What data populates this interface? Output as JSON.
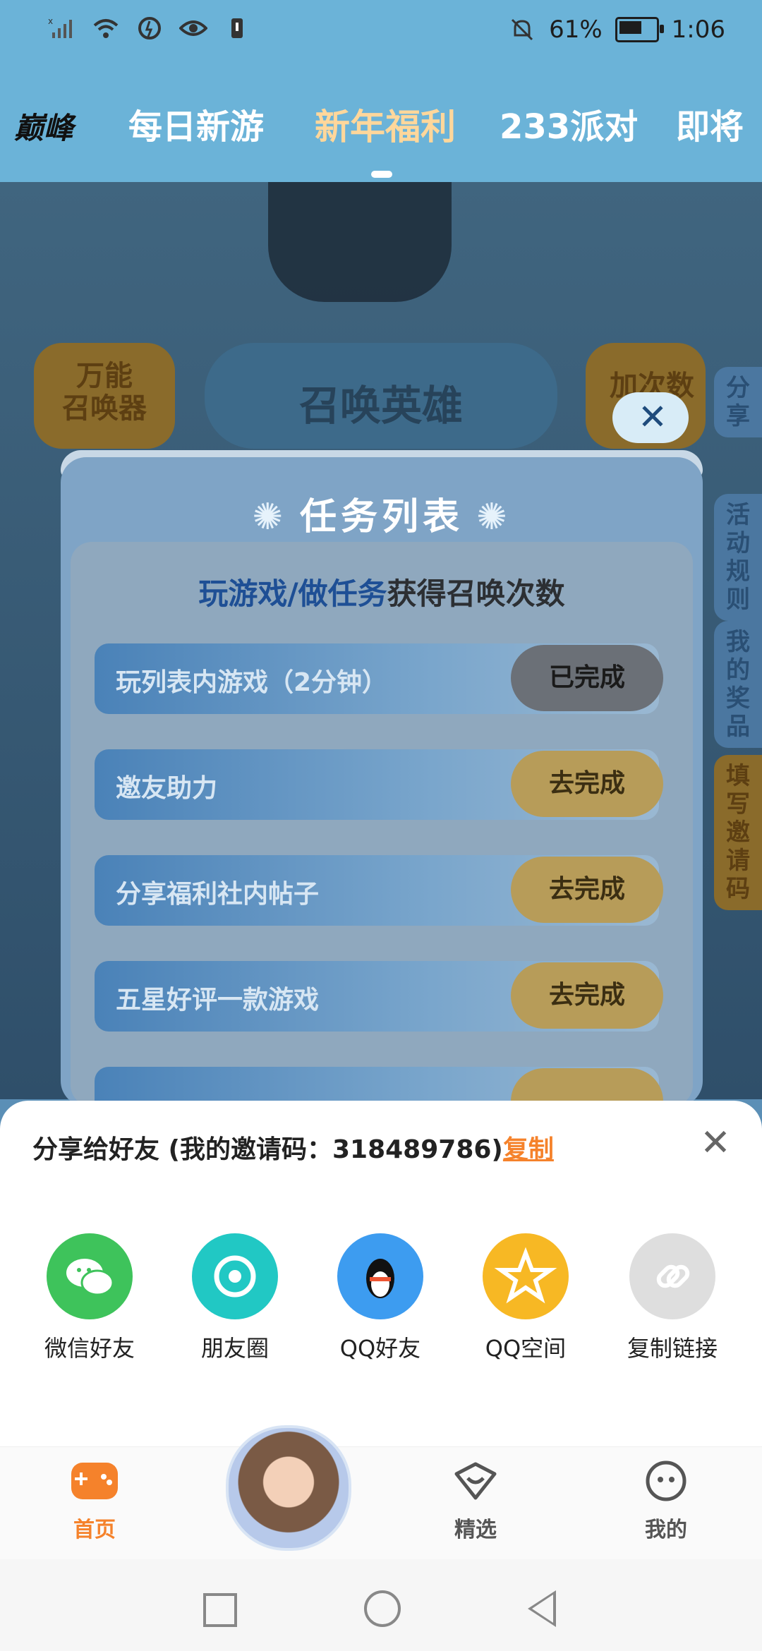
{
  "status_bar": {
    "battery_percent": "61%",
    "time": "1:06",
    "battery_level": 0.61,
    "icons": [
      "no-sim-signal-icon",
      "wifi-icon",
      "data-saver-icon",
      "eye-icon",
      "notification-icon",
      "mute-bell-icon",
      "battery-icon"
    ]
  },
  "top_tabs": {
    "items": [
      {
        "label": "巅峰",
        "active": false
      },
      {
        "label": "每日新游",
        "active": false
      },
      {
        "label": "新年福利",
        "active": true
      },
      {
        "label": "233派对",
        "active": false
      },
      {
        "label": "即将",
        "active": false
      }
    ]
  },
  "background": {
    "left_button": "万能\n召唤器",
    "main_button": "召唤英雄",
    "right_button": "加次数",
    "side_buttons": [
      "分享",
      "活动规则",
      "我的奖品",
      "填写邀请码"
    ]
  },
  "modal": {
    "title": "任务列表",
    "subtitle_highlight": "玩游戏/做任务",
    "subtitle_rest": "获得召唤次数",
    "tasks": [
      {
        "label": "玩列表内游戏（2分钟）",
        "button": "已完成",
        "done": true
      },
      {
        "label": "邀友助力",
        "button": "去完成",
        "done": false
      },
      {
        "label": "分享福利社内帖子",
        "button": "去完成",
        "done": false
      },
      {
        "label": "五星好评一款游戏",
        "button": "去完成",
        "done": false
      }
    ]
  },
  "share_sheet": {
    "title": "分享给好友 (我的邀请码：318489786)",
    "copy_label": "复制",
    "targets": [
      {
        "label": "微信好友",
        "color": "#3ec35b",
        "icon": "wechat-icon"
      },
      {
        "label": "朋友圈",
        "color": "#21c8c4",
        "icon": "moments-icon"
      },
      {
        "label": "QQ好友",
        "color": "#3d9cf0",
        "icon": "qq-penguin-icon"
      },
      {
        "label": "QQ空间",
        "color": "#f7b824",
        "icon": "qzone-star-icon"
      },
      {
        "label": "复制链接",
        "color": "#dedede",
        "icon": "link-icon"
      }
    ]
  },
  "bottom_nav": {
    "items": [
      {
        "label": "首页",
        "active": true,
        "icon": "gamepad-icon"
      },
      {
        "label": "精选",
        "active": false,
        "icon": "heart-chat-icon"
      },
      {
        "label": "我的",
        "active": false,
        "icon": "smile-face-icon"
      }
    ]
  },
  "colors": {
    "accent": "#f5822b",
    "tab_active": "#ffd79b",
    "topbar": "#6bb3d8"
  }
}
